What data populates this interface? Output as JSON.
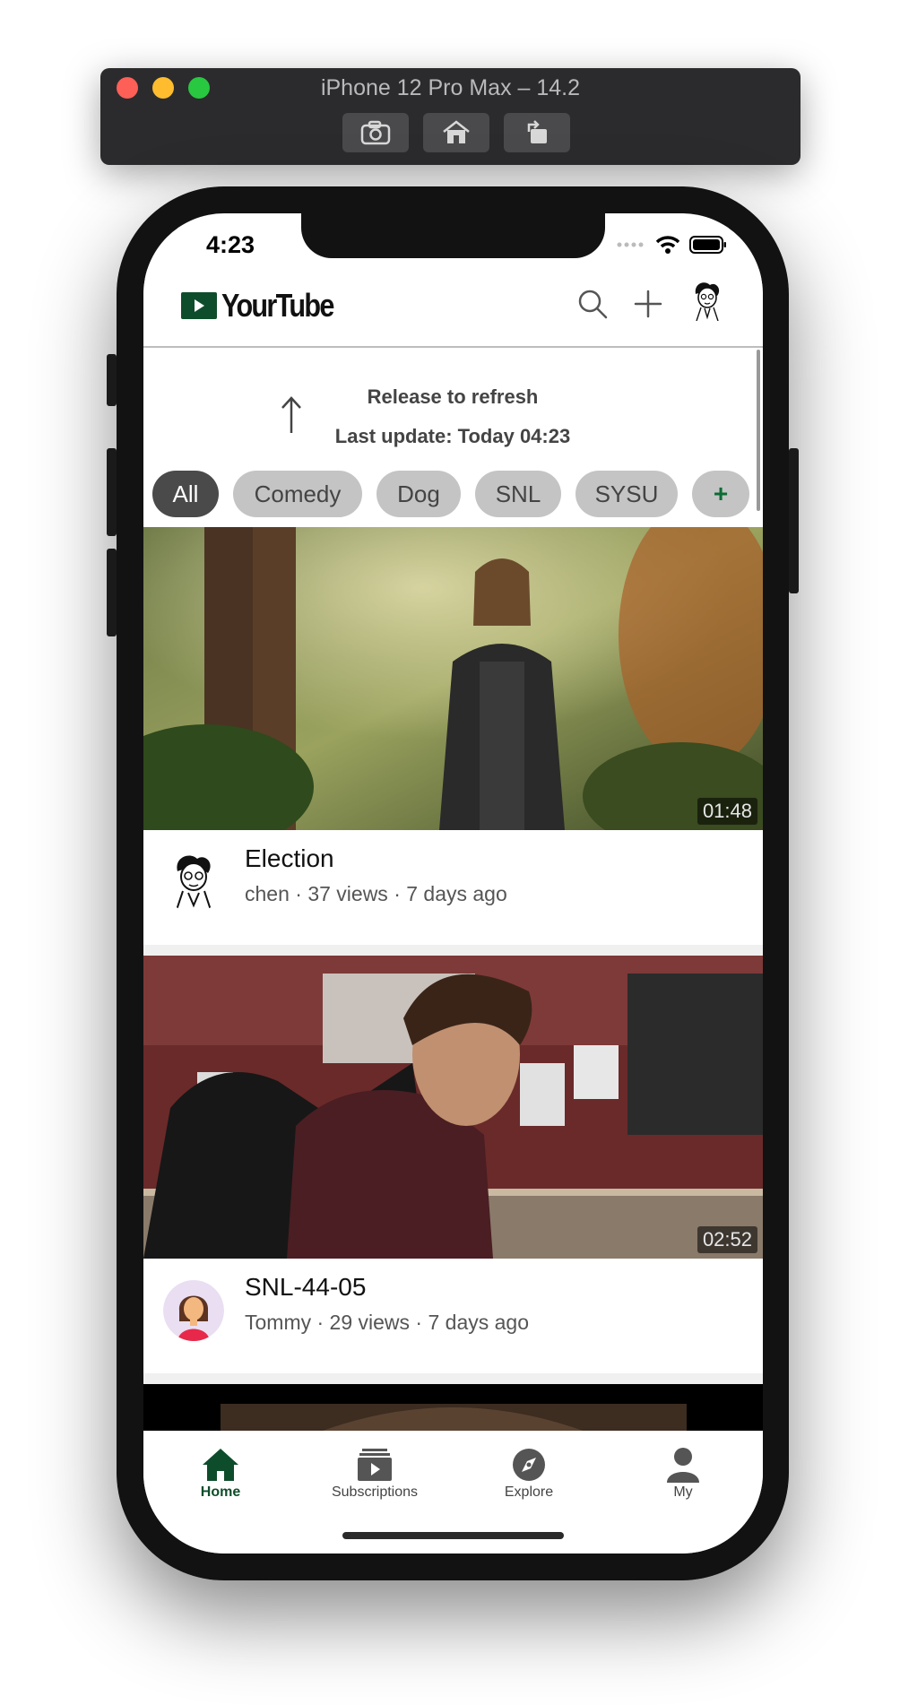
{
  "simulator": {
    "title": "iPhone 12 Pro Max – 14.2",
    "buttons": [
      "screenshot",
      "home",
      "rotate"
    ]
  },
  "status_bar": {
    "time": "4:23"
  },
  "app": {
    "logo_text": "YourTube",
    "brand_color": "#0e4d2b",
    "header_icons": [
      "search-icon",
      "plus-icon",
      "avatar"
    ]
  },
  "refresh": {
    "title": "Release to refresh",
    "last_update": "Last update: Today 04:23"
  },
  "chips": [
    {
      "label": "All",
      "active": true
    },
    {
      "label": "Comedy",
      "active": false
    },
    {
      "label": "Dog",
      "active": false
    },
    {
      "label": "SNL",
      "active": false
    },
    {
      "label": "SYSU",
      "active": false
    },
    {
      "label": "+",
      "active": false
    }
  ],
  "videos": [
    {
      "title": "Election",
      "subtitle": "chen · 37 views · 7 days ago",
      "duration": "01:48"
    },
    {
      "title": "SNL-44-05",
      "subtitle": "Tommy · 29 views · 7 days ago",
      "duration": "02:52"
    }
  ],
  "tabs": [
    {
      "label": "Home",
      "icon": "home-icon",
      "active": true
    },
    {
      "label": "Subscriptions",
      "icon": "subscriptions-icon",
      "active": false
    },
    {
      "label": "Explore",
      "icon": "compass-icon",
      "active": false
    },
    {
      "label": "My",
      "icon": "person-icon",
      "active": false
    }
  ]
}
